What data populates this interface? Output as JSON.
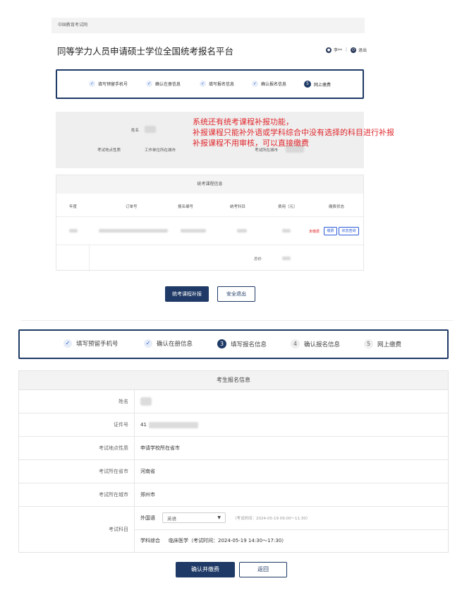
{
  "top": {
    "site_name": "中国教育考试网",
    "page_title": "同等学力人员申请硕士学位全国统考报名平台",
    "user": {
      "name_masked": "李**",
      "logout": "退出"
    },
    "steps": [
      {
        "label": "填写预留手机号",
        "state": "done"
      },
      {
        "label": "确认在册信息",
        "state": "done"
      },
      {
        "label": "填写报名信息",
        "state": "done"
      },
      {
        "label": "确认报名信息",
        "state": "done"
      },
      {
        "label": "网上缴费",
        "state": "active",
        "num": "5"
      }
    ],
    "info": {
      "name_label": "姓名",
      "exam_place_label": "考试地点性质",
      "exam_place_value": "工作单位所在城市",
      "exam_city_label": "考试所在城市"
    },
    "note_lines": [
      "系统还有统考课程补报功能，",
      "补报课程只能补外语或学科综合中没有选择的科目进行补报",
      "补报课程不用审核，可以直接缴费"
    ],
    "fee_table": {
      "title": "统考课程信息",
      "columns": [
        "年度",
        "订单号",
        "报名编号",
        "统考科目",
        "费用（元）",
        "缴费状态"
      ],
      "status_text": "未缴费",
      "action_pay": "缴费",
      "action_query": "状态查询",
      "total_label": "总价"
    },
    "buttons": {
      "supplement": "统考课程补报",
      "logout": "安全退出"
    }
  },
  "bottom": {
    "steps": [
      {
        "label": "填写预留手机号",
        "state": "done"
      },
      {
        "label": "确认在册信息",
        "state": "done"
      },
      {
        "label": "填写报名信息",
        "state": "active",
        "num": "3"
      },
      {
        "label": "确认报名信息",
        "state": "todo",
        "num": "4"
      },
      {
        "label": "网上缴费",
        "state": "todo",
        "num": "5"
      }
    ],
    "form": {
      "title": "考生报名信息",
      "rows": {
        "name": {
          "label": "姓名"
        },
        "id": {
          "label": "证件号",
          "value_prefix": "41"
        },
        "exam_place": {
          "label": "考试地点性质",
          "value": "申请学校所在省市"
        },
        "province": {
          "label": "考试所在省市",
          "value": "河南省"
        },
        "city": {
          "label": "考试所在城市",
          "value": "郑州市"
        },
        "subjects": {
          "label": "考试科目",
          "foreign_label": "外国语",
          "foreign_selected": "英语",
          "foreign_time": "（考试时间：2024-05-19 09:00～11:30）",
          "comprehensive_label": "学科综合",
          "comprehensive_value": "临床医学（考试时间：2024-05-19 14:30～17:30）"
        }
      }
    },
    "buttons": {
      "confirm": "确认并缴费",
      "back": "返回"
    }
  }
}
